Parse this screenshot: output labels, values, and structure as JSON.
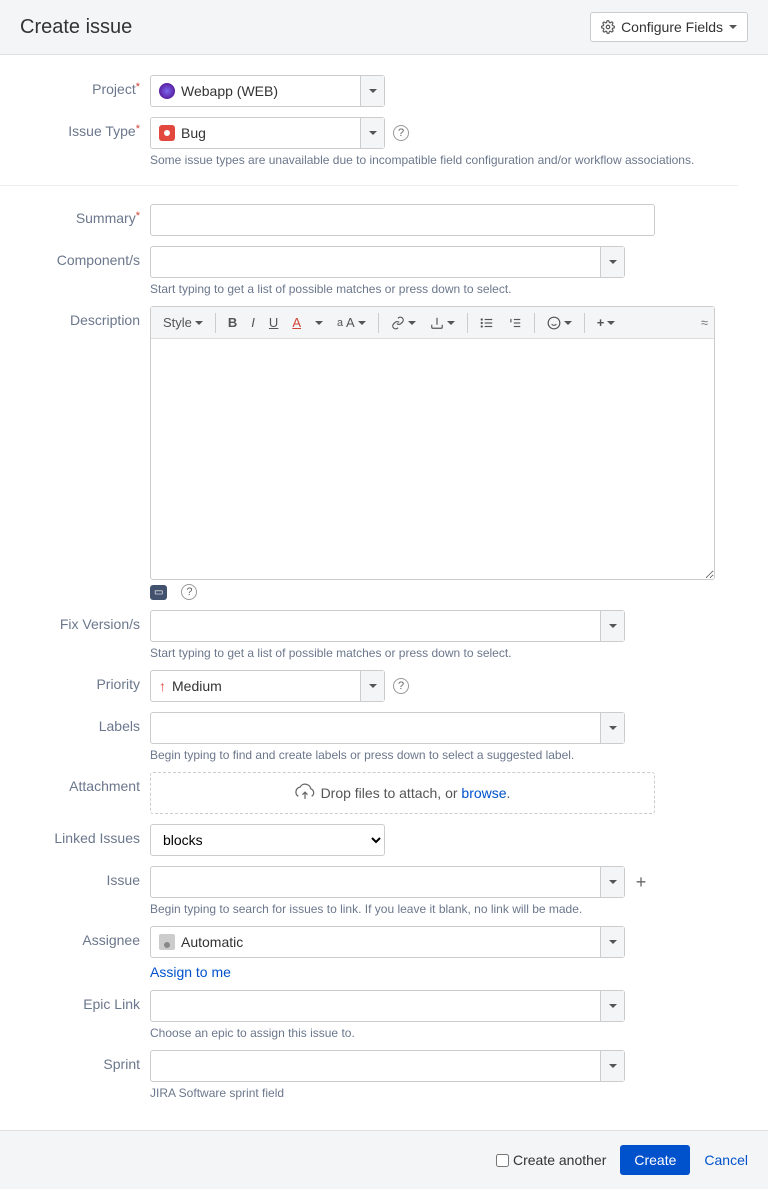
{
  "header": {
    "title": "Create issue",
    "configure_label": "Configure Fields"
  },
  "fields": {
    "project": {
      "label": "Project",
      "value": "Webapp (WEB)"
    },
    "issueType": {
      "label": "Issue Type",
      "value": "Bug",
      "hint": "Some issue types are unavailable due to incompatible field configuration and/or workflow associations."
    },
    "summary": {
      "label": "Summary"
    },
    "components": {
      "label": "Component/s",
      "hint": "Start typing to get a list of possible matches or press down to select."
    },
    "description": {
      "label": "Description",
      "style_label": "Style"
    },
    "fixVersions": {
      "label": "Fix Version/s",
      "hint": "Start typing to get a list of possible matches or press down to select."
    },
    "priority": {
      "label": "Priority",
      "value": "Medium"
    },
    "labels": {
      "label": "Labels",
      "hint": "Begin typing to find and create labels or press down to select a suggested label."
    },
    "attachment": {
      "label": "Attachment",
      "drop_text": "Drop files to attach, or ",
      "browse_text": "browse"
    },
    "linkedIssues": {
      "label": "Linked Issues",
      "value": "blocks"
    },
    "issue": {
      "label": "Issue",
      "hint": "Begin typing to search for issues to link. If you leave it blank, no link will be made."
    },
    "assignee": {
      "label": "Assignee",
      "value": "Automatic",
      "assign_to_me": "Assign to me"
    },
    "epicLink": {
      "label": "Epic Link",
      "hint": "Choose an epic to assign this issue to."
    },
    "sprint": {
      "label": "Sprint",
      "hint": "JIRA Software sprint field"
    }
  },
  "footer": {
    "create_another": "Create another",
    "create": "Create",
    "cancel": "Cancel"
  }
}
